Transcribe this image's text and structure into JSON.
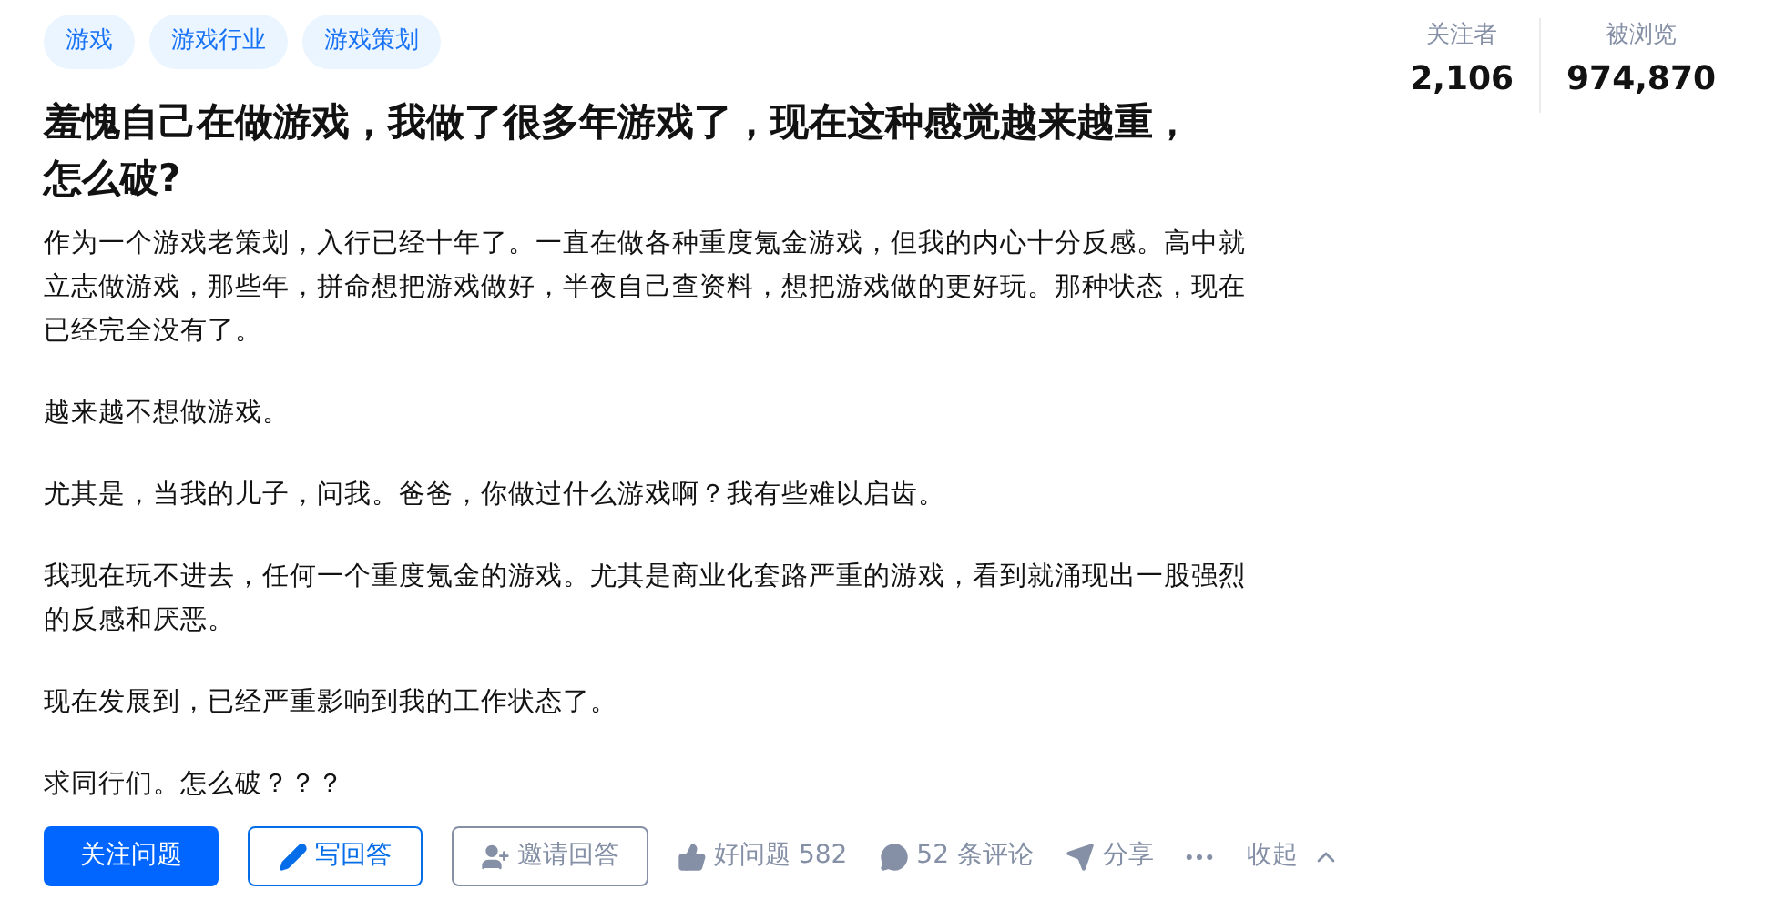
{
  "tags": [
    "游戏",
    "游戏行业",
    "游戏策划"
  ],
  "title": "羞愧自己在做游戏，我做了很多年游戏了，现在这种感觉越来越重，怎么破?",
  "paragraphs": [
    "作为一个游戏老策划，入行已经十年了。一直在做各种重度氪金游戏，但我的内心十分反感。高中就立志做游戏，那些年，拼命想把游戏做好，半夜自己查资料，想把游戏做的更好玩。那种状态，现在已经完全没有了。",
    "越来越不想做游戏。",
    "尤其是，当我的儿子，问我。爸爸，你做过什么游戏啊？我有些难以启齿。",
    "我现在玩不进去，任何一个重度氪金的游戏。尤其是商业化套路严重的游戏，看到就涌现出一股强烈的反感和厌恶。",
    "现在发展到，已经严重影响到我的工作状态了。",
    "求同行们。怎么破？？？"
  ],
  "stats": [
    {
      "label": "关注者",
      "value": "2,106"
    },
    {
      "label": "被浏览",
      "value": "974,870"
    }
  ],
  "buttons": [
    {
      "kind": "primary",
      "label": "关注问题"
    },
    {
      "kind": "write",
      "label": "写回答"
    },
    {
      "kind": "invite",
      "label": "邀请回答"
    }
  ],
  "actions": [
    {
      "kind": "like",
      "label": "好问题 582"
    },
    {
      "kind": "comment",
      "label": "52 条评论"
    },
    {
      "kind": "share",
      "label": "分享"
    },
    {
      "kind": "more"
    },
    {
      "kind": "collapse",
      "label": "收起"
    }
  ]
}
